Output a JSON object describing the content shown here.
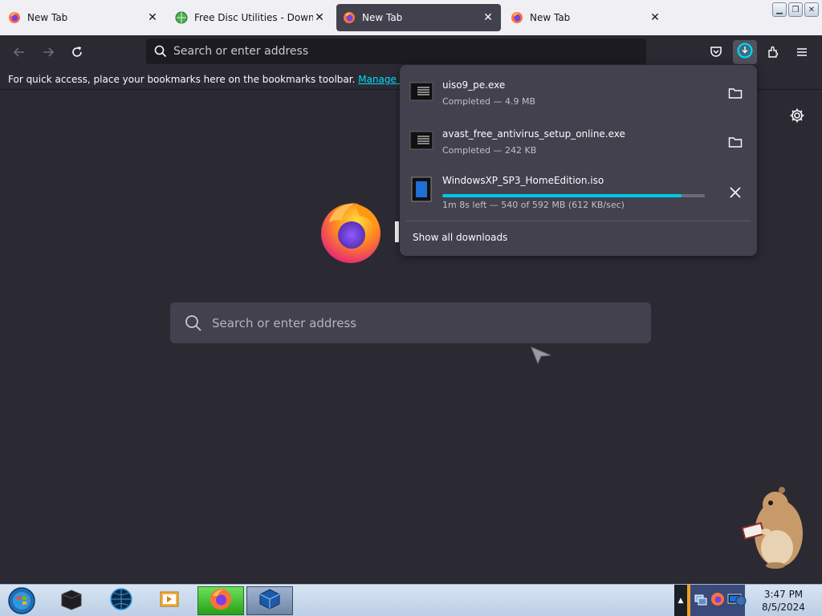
{
  "tabs": [
    {
      "title": "New Tab",
      "favicon": "firefox-icon",
      "active": false
    },
    {
      "title": "Free Disc Utilities - Download",
      "favicon": "globe-icon",
      "active": false
    },
    {
      "title": "New Tab",
      "favicon": "firefox-icon",
      "active": true
    },
    {
      "title": "New Tab",
      "favicon": "firefox-icon",
      "active": false
    }
  ],
  "navbar": {
    "url_placeholder": "Search or enter address"
  },
  "bookmarks_bar": {
    "message": "For quick access, place your bookmarks here on the bookmarks toolbar.",
    "manage_link": "Manage bookmarks..."
  },
  "content": {
    "search_placeholder": "Search or enter address"
  },
  "downloads": {
    "items": [
      {
        "name": "uiso9_pe.exe",
        "status": "Completed — 4.9 MB",
        "state": "completed",
        "action_icon": "folder-icon"
      },
      {
        "name": "avast_free_antivirus_setup_online.exe",
        "status": "Completed — 242 KB",
        "state": "completed",
        "action_icon": "folder-icon"
      },
      {
        "name": "WindowsXP_SP3_HomeEdition.iso",
        "status": "1m 8s left — 540 of 592 MB (612 KB/sec)",
        "state": "in-progress",
        "progress": 0.912,
        "action_icon": "close-icon"
      }
    ],
    "show_all_label": "Show all downloads"
  },
  "colors": {
    "accent": "#00ddff",
    "progress": "#00c8e8",
    "panel_bg": "#42414d",
    "page_bg": "#2b2a33"
  },
  "taskbar": {
    "items": [
      "start-orb-icon",
      "dark-box-app-icon",
      "globe-app-icon",
      "media-player-icon",
      "firefox-icon",
      "virtualbox-icon"
    ],
    "clock_time": "3:47 PM",
    "clock_date": "8/5/2024"
  }
}
